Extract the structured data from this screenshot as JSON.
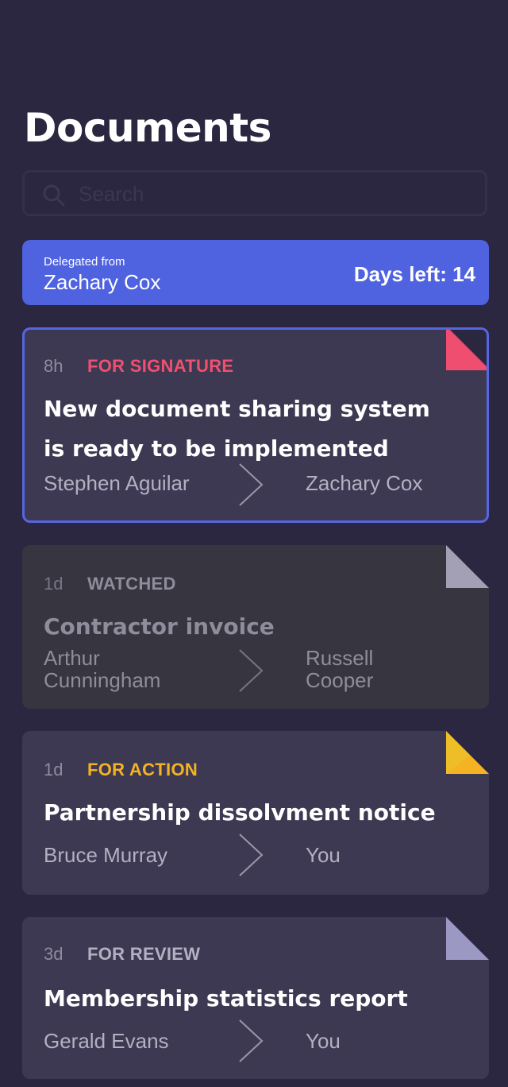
{
  "page": {
    "title": "Documents"
  },
  "search": {
    "placeholder": "Search",
    "icon": "search-icon"
  },
  "delegation": {
    "label": "Delegated from",
    "name": "Zachary Cox",
    "days_left_text": "Days left: 14"
  },
  "colors": {
    "background": "#2b2740",
    "banner": "#4f63e0",
    "card": "#3d3952",
    "card_dim": "#37353f",
    "signature": "#f0506e",
    "watched": "#8f8c9c",
    "action": "#f5b324",
    "review": "#b3b0c2",
    "active_border": "#5566e0"
  },
  "documents": [
    {
      "age": "8h",
      "status": "FOR SIGNATURE",
      "title": "New document sharing system is ready to be implemented",
      "from": "Stephen Aguilar",
      "to": "Zachary Cox",
      "fold_color": "pink"
    },
    {
      "age": "1d",
      "status": "WATCHED",
      "title": "Contractor invoice",
      "from": "Arthur Cunningham",
      "to": "Russell Cooper",
      "fold_color": "gray"
    },
    {
      "age": "1d",
      "status": "FOR ACTION",
      "title": "Partnership dissolvment notice",
      "from": "Bruce Murray",
      "to": "You",
      "fold_color": "yellow"
    },
    {
      "age": "3d",
      "status": "FOR REVIEW",
      "title": "Membership statistics report",
      "from": "Gerald Evans",
      "to": "You",
      "fold_color": "lavender"
    }
  ]
}
